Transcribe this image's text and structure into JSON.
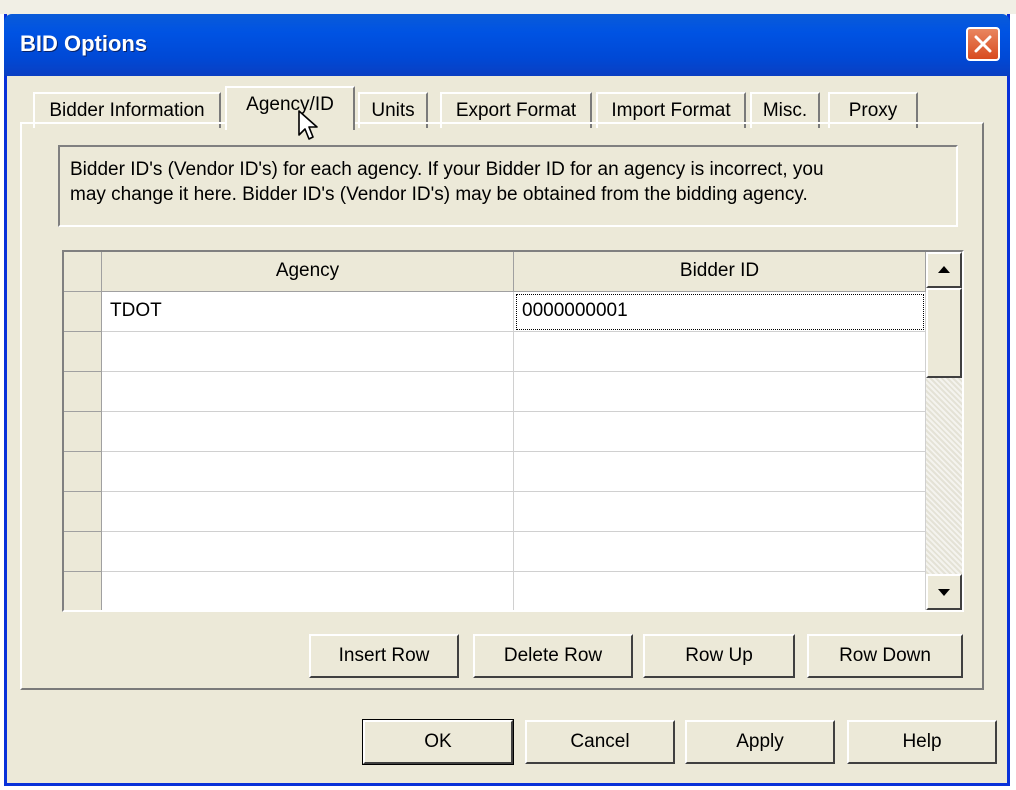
{
  "window": {
    "title": "BID Options"
  },
  "tabs": [
    {
      "label": "Bidder Information",
      "active": false
    },
    {
      "label": "Agency/ID",
      "active": true
    },
    {
      "label": "Units",
      "active": false
    },
    {
      "label": "Export Format",
      "active": false
    },
    {
      "label": "Import Format",
      "active": false
    },
    {
      "label": "Misc.",
      "active": false
    },
    {
      "label": "Proxy",
      "active": false
    }
  ],
  "info": {
    "line1": "Bidder ID's (Vendor ID's) for each agency.  If your Bidder ID for an agency is incorrect, you",
    "line2": "may change it here.  Bidder ID's (Vendor ID's) may be obtained from the bidding agency."
  },
  "grid": {
    "columns": [
      "Agency",
      "Bidder ID"
    ],
    "rows": [
      [
        "TDOT",
        "0000000001"
      ],
      [
        "",
        ""
      ],
      [
        "",
        ""
      ],
      [
        "",
        ""
      ],
      [
        "",
        ""
      ],
      [
        "",
        ""
      ],
      [
        "",
        ""
      ],
      [
        "",
        ""
      ]
    ]
  },
  "row_buttons": {
    "insert": "Insert Row",
    "delete": "Delete Row",
    "up": "Row Up",
    "down": "Row Down"
  },
  "dialog_buttons": {
    "ok": "OK",
    "cancel": "Cancel",
    "apply": "Apply",
    "help": "Help"
  },
  "icons": {
    "close": "close-icon",
    "scroll_up": "arrow-up-icon",
    "scroll_down": "arrow-down-icon",
    "cursor": "mouse-pointer-icon"
  },
  "colors": {
    "titlebar": "#0053e3",
    "dialog_bg": "#ece9d8",
    "close_button": "#d84b21"
  }
}
